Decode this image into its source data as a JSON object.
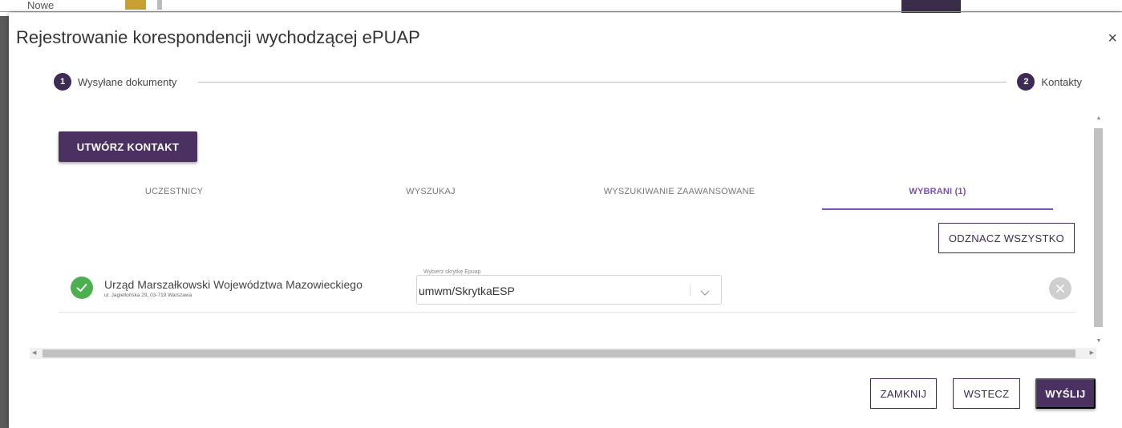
{
  "background": {
    "partial_text": "Nowe"
  },
  "dialog": {
    "title": "Rejestrowanie korespondencji wychodzącej ePUAP",
    "close_symbol": "×"
  },
  "stepper": {
    "steps": [
      {
        "number": "1",
        "label": "Wysyłane dokumenty"
      },
      {
        "number": "2",
        "label": "Kontakty"
      }
    ]
  },
  "create_contact_label": "UTWÓRZ KONTAKT",
  "tabs": [
    {
      "label": "UCZESTNICY",
      "active": false
    },
    {
      "label": "WYSZUKAJ",
      "active": false
    },
    {
      "label": "WYSZUKIWANIE ZAAWANSOWANE",
      "active": false
    },
    {
      "label": "WYBRANI (1)",
      "active": true
    }
  ],
  "unselect_all_label": "ODZNACZ WSZYSTKO",
  "contacts": [
    {
      "name": "Urząd Marszałkowski Województwa Mazowieckiego",
      "address": "ul. Jagiellońska 29, 03-719 Warszawa",
      "mailbox_label": "Wybierz skrytkę Epuap",
      "mailbox_value": "umwm/SkrytkaESP",
      "icon": "check-circle-icon"
    }
  ],
  "footer": {
    "close_label": "ZAMKNIJ",
    "back_label": "WSTECZ",
    "send_label": "WYŚLIJ"
  },
  "colors": {
    "primary": "#4a3161",
    "accent_tab": "#7a4fc2",
    "success": "#4caf50"
  }
}
